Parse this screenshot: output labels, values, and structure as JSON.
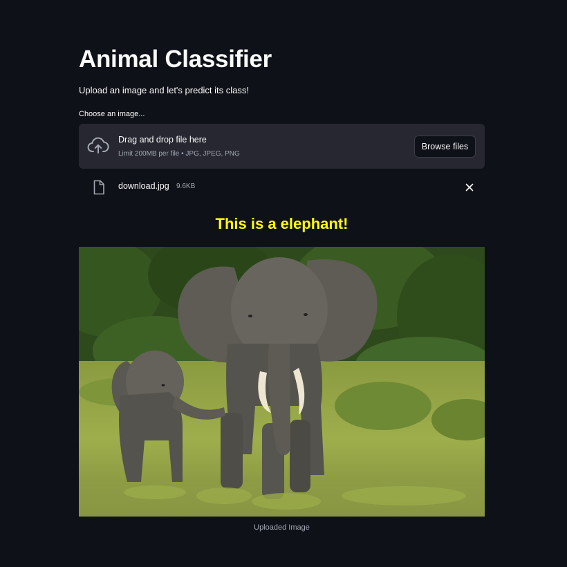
{
  "app": {
    "title": "Animal Classifier",
    "subtitle": "Upload an image and let's predict its class!"
  },
  "uploader": {
    "label": "Choose an image...",
    "instructions": "Drag and drop file here",
    "limit": "Limit 200MB per file • JPG, JPEG, PNG",
    "browse_label": "Browse files",
    "cloud_icon": "cloud-upload-icon"
  },
  "file": {
    "name": "download.jpg",
    "size": "9.6KB",
    "file_icon": "file-icon",
    "remove_icon": "close-icon"
  },
  "result": {
    "prediction": "This is a elephant!"
  },
  "image": {
    "caption": "Uploaded Image"
  },
  "colors": {
    "background": "#0e1117",
    "dropzone": "#262730",
    "prediction": "#ffff00",
    "muted_text": "#a3a8b4",
    "text": "#fafafa"
  }
}
